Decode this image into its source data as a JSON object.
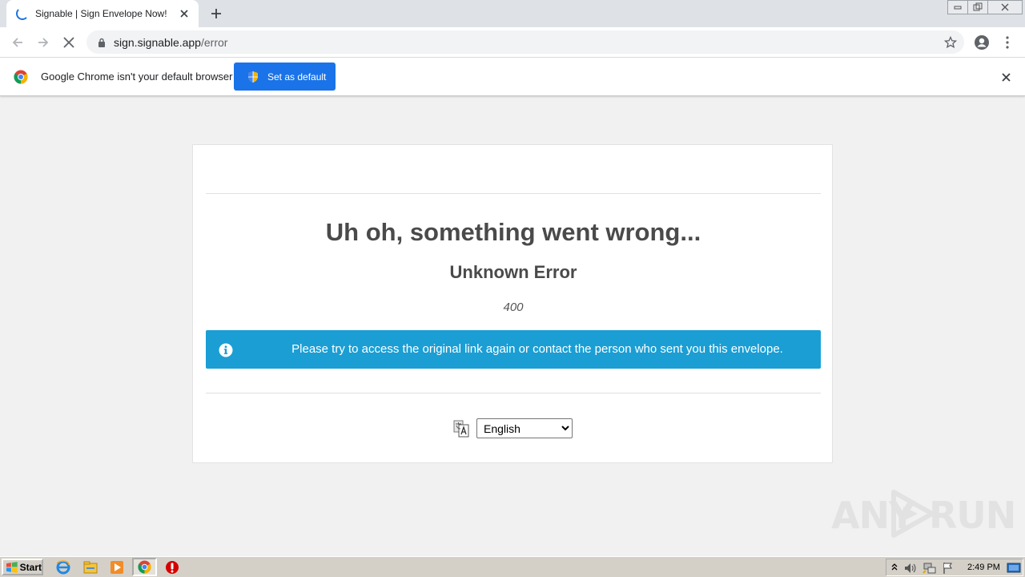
{
  "browser": {
    "tab_title": "Signable | Sign Envelope Now!",
    "url_host": "sign.signable.app",
    "url_path": "/error"
  },
  "infobar": {
    "message": "Google Chrome isn't your default browser",
    "button_label": "Set as default"
  },
  "page": {
    "heading": "Uh oh, something went wrong...",
    "subheading": "Unknown Error",
    "error_code": "400",
    "alert_message": "Please try to access the original link again or contact the person who sent you this envelope.",
    "language_selected": "English"
  },
  "watermark": {
    "text_left": "ANY",
    "text_right": "RUN"
  },
  "taskbar": {
    "start_label": "Start",
    "clock": "2:49 PM"
  },
  "colors": {
    "alert_bg": "#1a9ed4",
    "primary_button": "#1a73e8",
    "heading_text": "#4a4a4a"
  }
}
